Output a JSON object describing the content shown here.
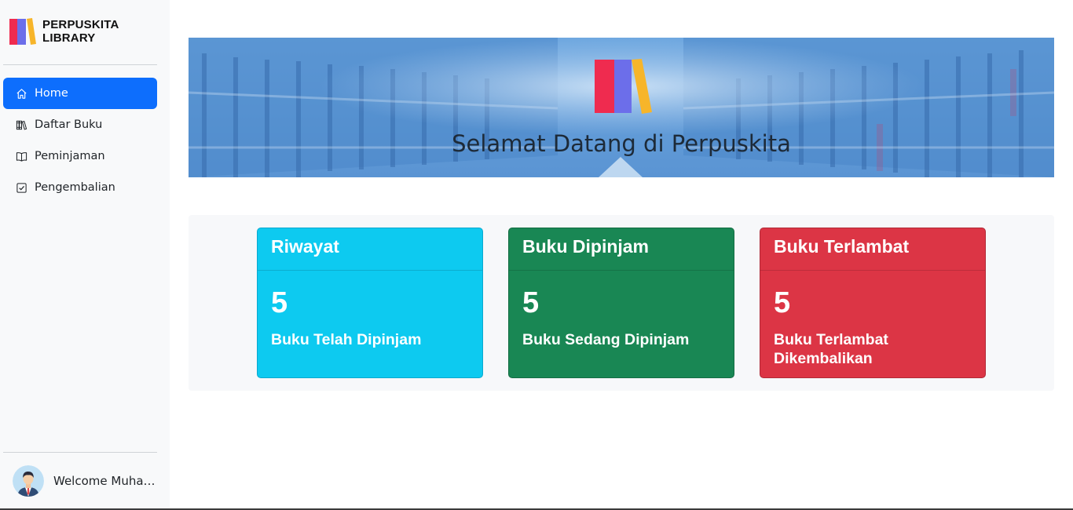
{
  "brand": {
    "line1": "PERPUSKITA",
    "line2": "LIBRARY",
    "logo_colors": [
      "#ef2b4f",
      "#6c6eea",
      "#f7b52a"
    ]
  },
  "sidebar": {
    "items": [
      {
        "label": "Home",
        "icon": "home-icon",
        "active": true
      },
      {
        "label": "Daftar Buku",
        "icon": "books-icon",
        "active": false
      },
      {
        "label": "Peminjaman",
        "icon": "open-book-icon",
        "active": false
      },
      {
        "label": "Pengembalian",
        "icon": "check-square-icon",
        "active": false
      }
    ]
  },
  "user": {
    "welcome": "Welcome Muham..."
  },
  "banner": {
    "title": "Selamat Datang di Perpuskita"
  },
  "cards": [
    {
      "title": "Riwayat",
      "count": "5",
      "text": "Buku Telah Dipinjam",
      "color": "#0dcaf0"
    },
    {
      "title": "Buku Dipinjam",
      "count": "5",
      "text": "Buku Sedang Dipinjam",
      "color": "#198754"
    },
    {
      "title": "Buku Terlambat",
      "count": "5",
      "text": "Buku Terlambat Dikembalikan",
      "color": "#dc3545"
    }
  ],
  "colors": {
    "accent": "#0d6efd",
    "sidebar_bg": "#f8f9fa"
  }
}
